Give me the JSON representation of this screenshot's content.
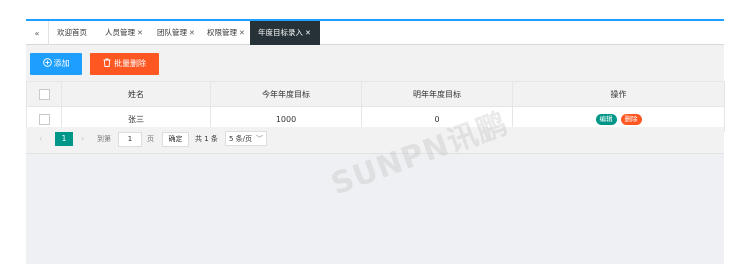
{
  "tabs": [
    {
      "label": "欢迎首页",
      "closable": false,
      "active": false
    },
    {
      "label": "人员管理",
      "closable": true,
      "active": false
    },
    {
      "label": "团队管理",
      "closable": true,
      "active": false
    },
    {
      "label": "权限管理",
      "closable": true,
      "active": false
    },
    {
      "label": "年度目标录入",
      "closable": true,
      "active": true
    }
  ],
  "tab_prev_icon": "«",
  "close_icon": "✕",
  "toolbar": {
    "add_label": "添加",
    "batch_delete_label": "批量删除"
  },
  "table": {
    "headers": [
      "姓名",
      "今年年度目标",
      "明年年度目标",
      "操作"
    ],
    "rows": [
      {
        "name": "张三",
        "this_year": "1000",
        "next_year": "0",
        "edit": "编辑",
        "delete": "删除"
      }
    ]
  },
  "pager": {
    "prev": "‹",
    "current": "1",
    "next": "›",
    "goto_label": "到第",
    "page_input": "1",
    "page_label": "页",
    "confirm_label": "确定",
    "total_label": "共 1 条",
    "page_size": "5 条/页"
  },
  "watermark": "SUNPN讯鹏",
  "colors": {
    "accent": "#1e9fff",
    "danger": "#ff5722",
    "teal": "#009688",
    "active_tab": "#263238"
  }
}
